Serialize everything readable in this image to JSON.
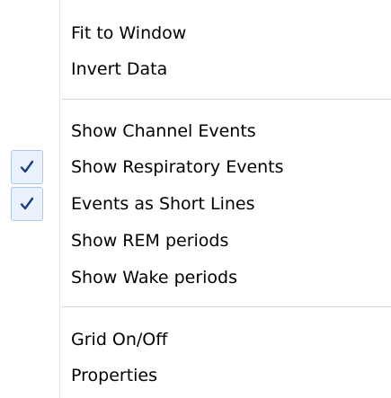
{
  "menu": {
    "items": [
      {
        "label": "Fit to Window",
        "checked": false
      },
      {
        "label": "Invert Data",
        "checked": false
      },
      {
        "label": "Show Channel Events",
        "checked": false
      },
      {
        "label": "Show Respiratory Events",
        "checked": true
      },
      {
        "label": "Events as Short Lines",
        "checked": true
      },
      {
        "label": "Show REM periods",
        "checked": false
      },
      {
        "label": "Show Wake periods",
        "checked": false
      },
      {
        "label": "Grid On/Off",
        "checked": false
      },
      {
        "label": "Properties",
        "checked": false
      }
    ],
    "colors": {
      "check_highlight_fill": "#eaf2fd",
      "check_highlight_border": "#a8c8f0",
      "check_mark": "#1a3a8a",
      "separator": "#d8d8d8"
    }
  }
}
